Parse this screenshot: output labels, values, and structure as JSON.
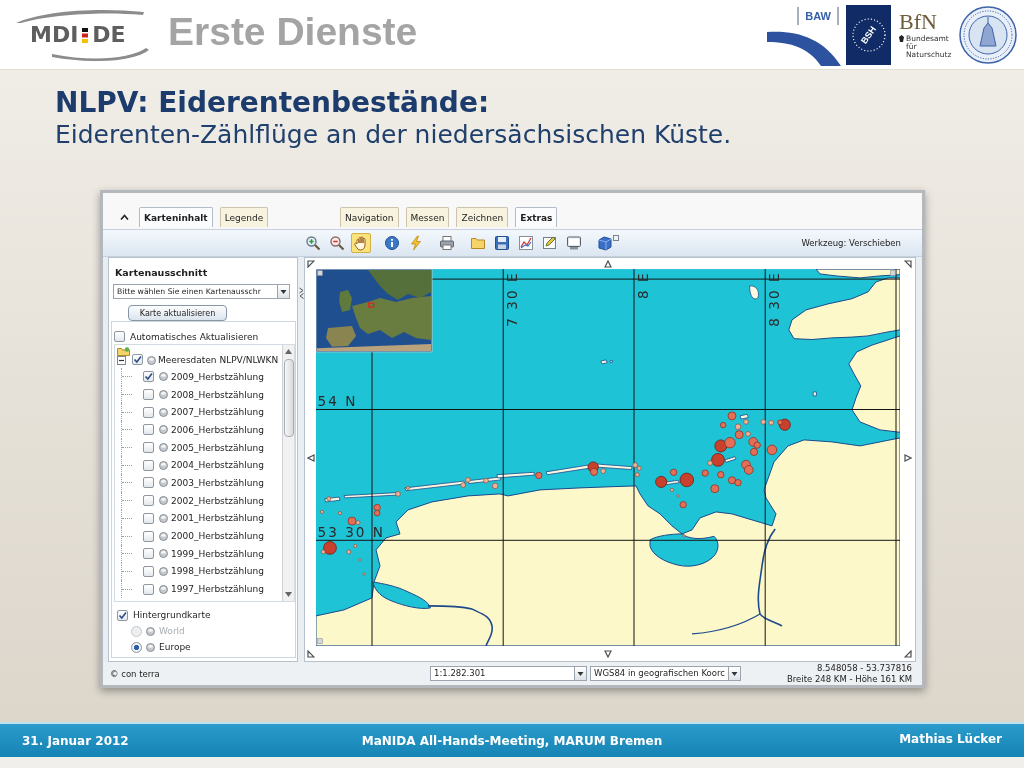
{
  "header": {
    "logo": {
      "left": "MDI",
      "right": "DE"
    },
    "title": "Erste Dienste",
    "partner_logos": [
      {
        "kind": "baw",
        "text": "BAW"
      },
      {
        "kind": "bsh",
        "text": "BSH"
      },
      {
        "kind": "bfn",
        "text": "BfN",
        "caption": "Bundesamt für Naturschutz"
      },
      {
        "kind": "seal"
      }
    ]
  },
  "slide": {
    "heading": "NLPV: Eiderentenbestände:",
    "subheading": "Eiderenten-Zählflüge an der niedersächsischen Küste."
  },
  "app": {
    "panel_tabs": [
      {
        "label": "Karteninhalt",
        "selected": true
      },
      {
        "label": "Legende",
        "selected": false
      }
    ],
    "tool_tabs": [
      {
        "label": "Navigation",
        "selected": false
      },
      {
        "label": "Messen",
        "selected": false
      },
      {
        "label": "Zeichnen",
        "selected": false
      },
      {
        "label": "Extras",
        "selected": true
      }
    ],
    "tool_groups": [
      {
        "tools": [
          {
            "kind": "zoomin",
            "selected": false
          },
          {
            "kind": "zoomout",
            "selected": false
          },
          {
            "kind": "pan",
            "selected": true
          }
        ]
      },
      {
        "tools": [
          {
            "kind": "info",
            "selected": false
          },
          {
            "kind": "flash",
            "selected": false
          }
        ]
      },
      {
        "tools": [
          {
            "kind": "print",
            "selected": false
          }
        ]
      },
      {
        "tools": [
          {
            "kind": "open",
            "selected": false
          },
          {
            "kind": "save",
            "selected": false
          },
          {
            "kind": "chart",
            "selected": false
          },
          {
            "kind": "edit",
            "selected": false
          },
          {
            "kind": "screen",
            "selected": false
          }
        ]
      },
      {
        "tools": [
          {
            "kind": "layers",
            "selected": false
          }
        ]
      }
    ],
    "tool_status": "Werkzeug: Verschieben",
    "sidebar": {
      "title": "Kartenausschnitt",
      "extent_select": {
        "value": "Bitte wählen Sie einen Kartenausschr"
      },
      "refresh_button": "Karte aktualisieren",
      "auto_refresh": {
        "label": "Automatisches Aktualisieren",
        "checked": false
      },
      "layers": [
        {
          "label": "Meeresdaten NLPV/NLWKN",
          "checked": true,
          "expanded": true,
          "children": [
            {
              "label": "2009_Herbstzählung",
              "checked": true
            },
            {
              "label": "2008_Herbstzählung",
              "checked": false
            },
            {
              "label": "2007_Herbstzählung",
              "checked": false
            },
            {
              "label": "2006_Herbstzählung",
              "checked": false
            },
            {
              "label": "2005_Herbstzählung",
              "checked": false
            },
            {
              "label": "2004_Herbstzählung",
              "checked": false
            },
            {
              "label": "2003_Herbstzählung",
              "checked": false
            },
            {
              "label": "2002_Herbstzählung",
              "checked": false
            },
            {
              "label": "2001_Herbstzählung",
              "checked": false
            },
            {
              "label": "2000_Herbstzählung",
              "checked": false
            },
            {
              "label": "1999_Herbstzählung",
              "checked": false
            },
            {
              "label": "1998_Herbstzählung",
              "checked": false
            },
            {
              "label": "1997_Herbstzählung",
              "checked": false
            }
          ]
        }
      ],
      "background_map": {
        "label": "Hintergrundkarte",
        "checked": true,
        "options": [
          {
            "label": "World",
            "selected": false,
            "disabled": true
          },
          {
            "label": "Europe",
            "selected": true,
            "disabled": false
          }
        ]
      }
    },
    "map": {
      "meridian_labels": [
        "7 30 E",
        "8 E",
        "8 30 E"
      ],
      "parallel_labels": [
        "54 N",
        "53 30 N"
      ]
    },
    "status_bar": {
      "copyright": "© con terra",
      "scale": "1:1.282.301",
      "projection": "WGS84 in geografischen Koorc",
      "coordinates": "8.548058 - 53.737816",
      "extent": "Breite 248 KM - Höhe 161 KM"
    }
  },
  "footer": {
    "date": "31. Januar 2012",
    "event": "MaNIDA All-Hands-Meeting, MARUM Bremen",
    "author": "Mathias Lücker"
  }
}
